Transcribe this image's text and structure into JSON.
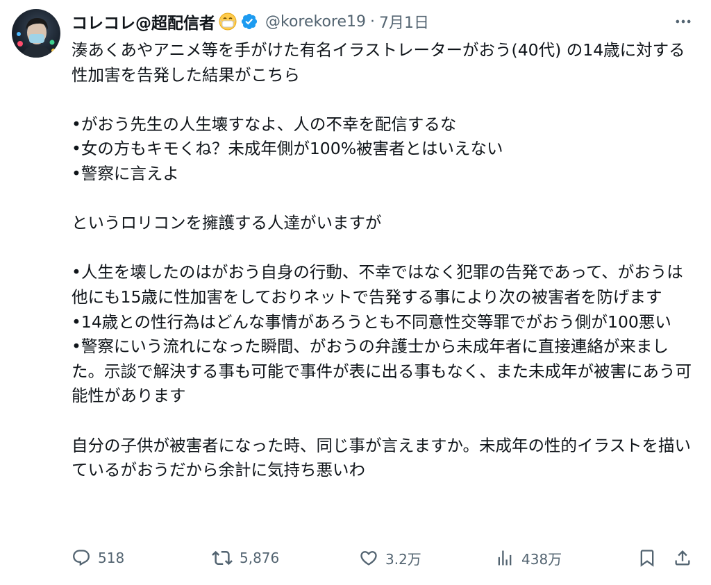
{
  "tweet": {
    "display_name": "コレコレ@超配信者",
    "handle": "@korekore19",
    "separator": "·",
    "date": "7月1日",
    "body": "湊あくあやアニメ等を手がけた有名イラストレーターがおう(40代) の14歳に対する性加害を告発した結果がこちら\n\n•がおう先生の人生壊すなよ、人の不幸を配信するな\n•女の方もキモくね？未成年側が100%被害者とはいえない\n•警察に言えよ\n\nというロリコンを擁護する人達がいますが\n\n•人生を壊したのはがおう自身の行動、不幸ではなく犯罪の告発であって、がおうは他にも15歳に性加害をしておりネットで告発する事により次の被害者を防げます\n•14歳との性行為はどんな事情があろうとも不同意性交等罪でがおう側が100悪い\n•警察にいう流れになった瞬間、がおうの弁護士から未成年者に直接連絡が来ました。示談で解決する事も可能で事件が表に出る事もなく、また未成年が被害にあう可能性があります\n\n自分の子供が被害者になった時、同じ事が言えますか。未成年の性的イラストを描いているがおうだから余計に気持ち悪いわ"
  },
  "actions": {
    "replies": "518",
    "reposts": "5,876",
    "likes": "3.2万",
    "views": "438万"
  },
  "icons": {
    "verified": "verified-badge-icon",
    "emoji": "face-with-mask-emoji-icon",
    "more": "more-options-icon",
    "reply": "reply-icon",
    "repost": "repost-icon",
    "like": "like-icon",
    "views": "views-icon",
    "bookmark": "bookmark-icon",
    "share": "share-icon"
  },
  "colors": {
    "text": "#0f1419",
    "secondary": "#536471",
    "verified": "#1d9bf0"
  }
}
